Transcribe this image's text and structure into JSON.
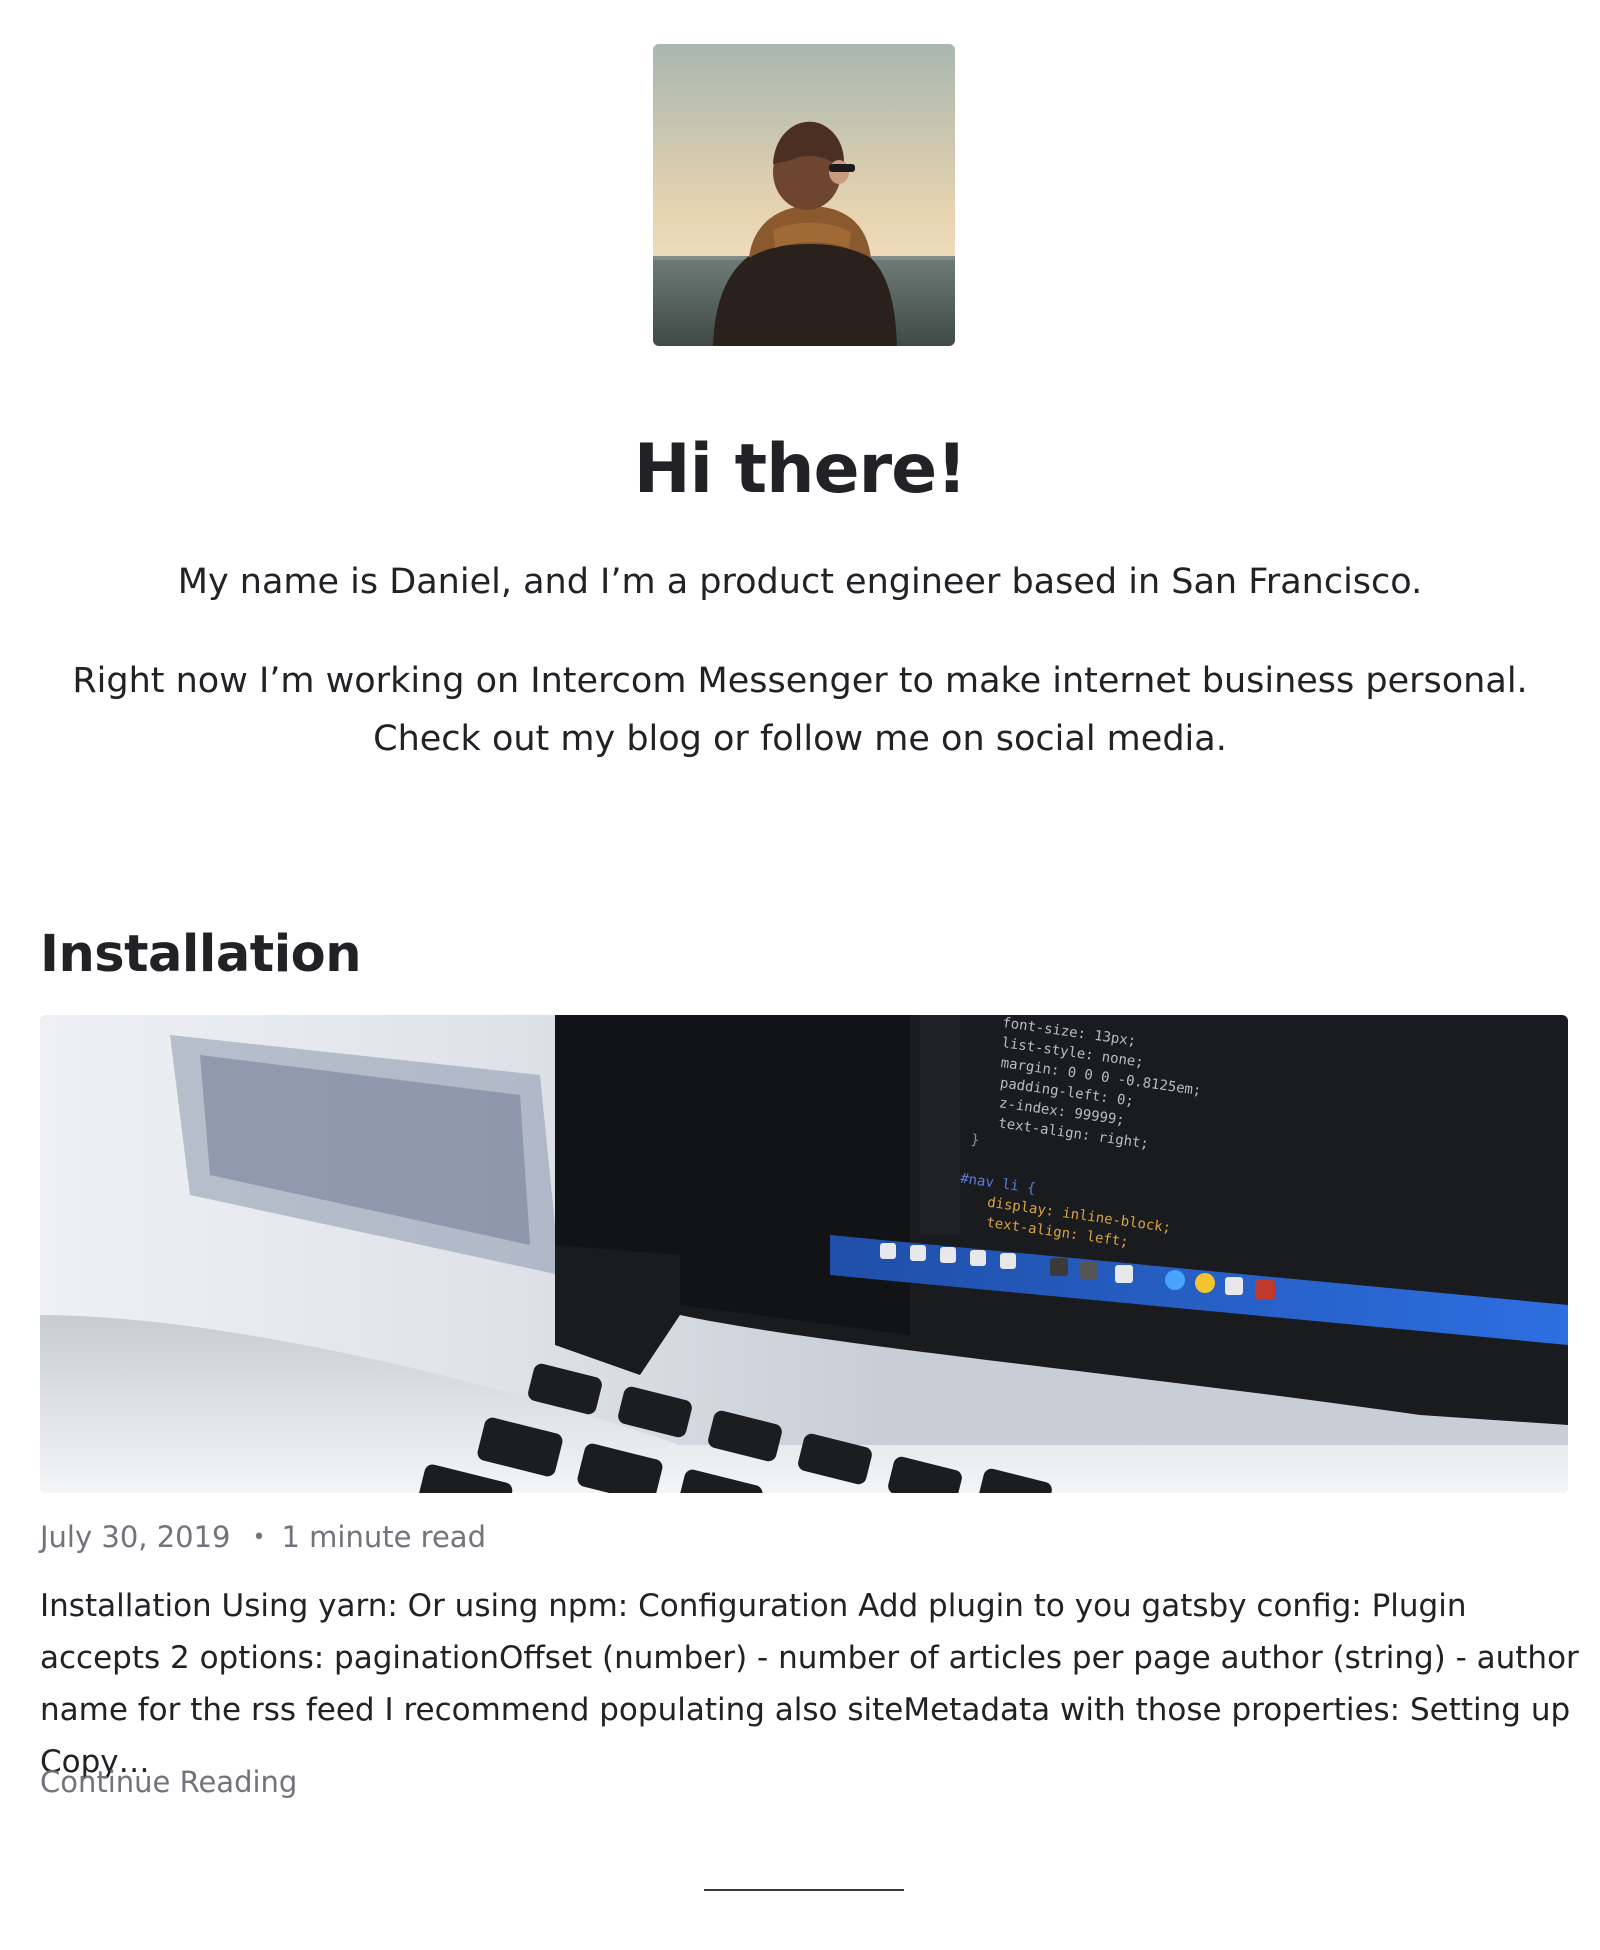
{
  "avatar": {
    "alt": "Portrait of a person in a scarf looking at the sea"
  },
  "intro": {
    "title": "Hi there!",
    "line1": "My name is Daniel, and I’m a product engineer based in San Francisco.",
    "line2": "Right now I’m working on Intercom Messenger to make internet business personal. Check out my blog or follow me on social media."
  },
  "article": {
    "title": "Installation",
    "image_alt": "Laptop showing CSS code on screen",
    "date": "July 30, 2019",
    "separator": "•",
    "read_time": "1 minute read",
    "excerpt": "Installation Using yarn: Or using npm: Configuration Add plugin to you gatsby config: Plugin accepts 2 options: paginationOffset (number) - number of articles per page author (string) - author name for the rss feed I recommend populating also siteMetadata with those properties: Setting up Copy…",
    "continue_label": "Continue Reading",
    "code_lines": [
      "font-size: 13px;",
      "list-style: none;",
      "margin: 0 0 0 -0.8125em;",
      "padding-left: 0;",
      "z-index: 99999;",
      "text-align: right;",
      "}",
      "#nav li {",
      "display: inline-block;",
      "text-align: left;"
    ]
  },
  "colors": {
    "text": "#212126",
    "muted": "#73737d",
    "background": "#ffffff"
  }
}
